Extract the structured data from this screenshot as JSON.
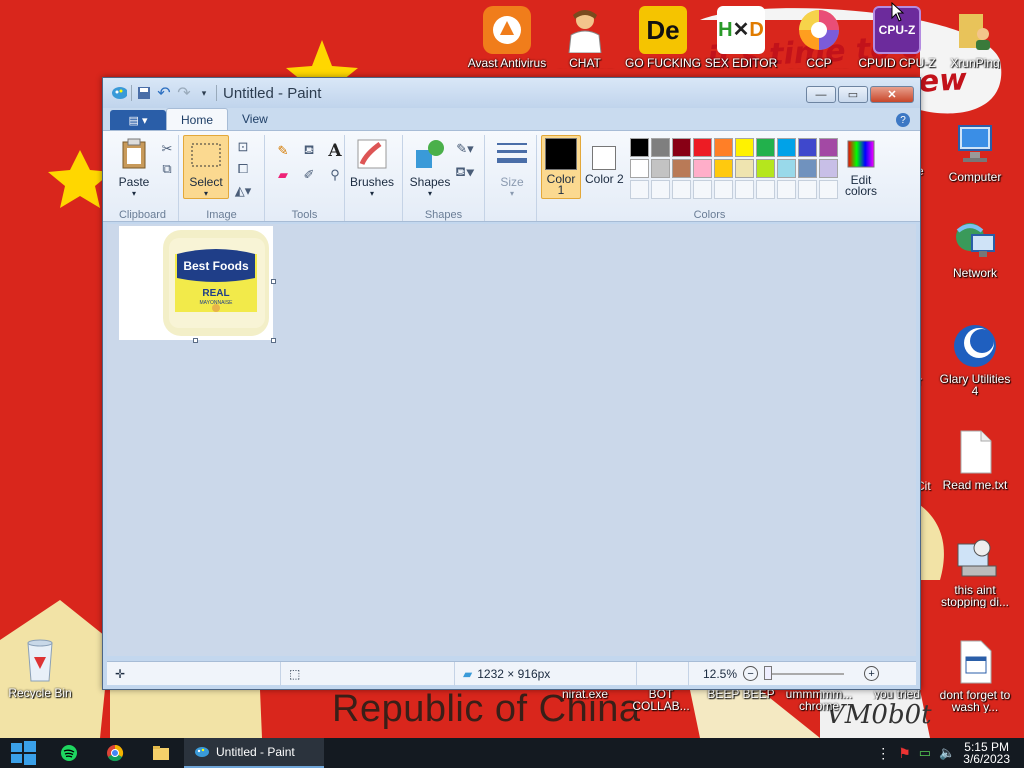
{
  "desktop": {
    "wallpaper_text": "Republic of China",
    "wallpaper_scrawl_lines": [
      "it's time to c",
      "ew"
    ],
    "wallpaper_signature": "VM0b0t",
    "icons_top": [
      {
        "label": "Avast Antivirus",
        "icon": "avast-icon",
        "color": "#f07d1b"
      },
      {
        "label": "CHAT SUPPORT",
        "icon": "doctor-icon",
        "color": "#ffffff"
      },
      {
        "label": "GO FUCKING DIE WHORE",
        "icon": "de-icon",
        "color": "#f5c400"
      },
      {
        "label": "SEX EDITOR",
        "icon": "hxd-icon",
        "color": "#ffffff"
      },
      {
        "label": "CCP BROWSER",
        "icon": "chromium-icon",
        "color": "#5a8fd8"
      },
      {
        "label": "CPUID CPU-Z",
        "icon": "cpuz-icon",
        "color": "#6c2b9c"
      },
      {
        "label": "XrunPing",
        "icon": "folder-user-icon",
        "color": "#e8c35a"
      }
    ],
    "icons_right": [
      {
        "label": "Computer",
        "icon": "computer-icon"
      },
      {
        "label": "Network",
        "icon": "network-icon"
      },
      {
        "label": "Glary Utilities 4",
        "icon": "glary-icon"
      },
      {
        "label": "Read me.txt",
        "icon": "text-file-icon"
      },
      {
        "label": "this aint stopping di...",
        "icon": "installer-icon"
      },
      {
        "label": "dont forget to wash y...",
        "icon": "calendar-file-icon"
      }
    ],
    "icons_bottom": [
      {
        "label": "nirat.exe",
        "icon": "exe-icon"
      },
      {
        "label": "BOT COLLAB...",
        "icon": "exe-icon"
      },
      {
        "label": "BEEP BEEP",
        "icon": "exe-icon"
      },
      {
        "label": "ummmmm... chrome",
        "icon": "exe-icon"
      },
      {
        "label": "you tried",
        "icon": "exe-icon"
      }
    ],
    "recycle_bin": "Recycle Bin",
    "partial_labels": [
      "e",
      "r",
      "Cit"
    ]
  },
  "paint": {
    "title": "Untitled - Paint",
    "tabs": [
      "Home",
      "View"
    ],
    "ribbon": {
      "clipboard": {
        "label": "Clipboard",
        "paste": "Paste"
      },
      "image": {
        "label": "Image",
        "select": "Select"
      },
      "tools": {
        "label": "Tools"
      },
      "brushes": "Brushes",
      "shapes": {
        "label": "Shapes",
        "button": "Shapes"
      },
      "size": "Size",
      "colors": {
        "label": "Colors",
        "color1": "Color 1",
        "color2": "Color 2",
        "edit": "Edit colors",
        "color1_value": "#000000",
        "color2_value": "#ffffff",
        "row1": [
          "#000000",
          "#7f7f7f",
          "#880015",
          "#ed1c24",
          "#ff7f27",
          "#fff200",
          "#22b14c",
          "#00a2e8",
          "#3f48cc",
          "#a349a4"
        ],
        "row2": [
          "#ffffff",
          "#c3c3c3",
          "#b97a57",
          "#ffaec9",
          "#ffc90e",
          "#efe4b0",
          "#b5e61d",
          "#99d9ea",
          "#7092be",
          "#c8bfe7"
        ]
      }
    },
    "image_label": {
      "brand": "Best Foods",
      "product": "REAL",
      "sub": "MAYONNAISE"
    },
    "status": {
      "dimensions": "1232 × 916px",
      "zoom": "12.5%"
    }
  },
  "taskbar": {
    "task_label": "Untitled - Paint",
    "time": "5:15 PM",
    "date": "3/6/2023"
  }
}
